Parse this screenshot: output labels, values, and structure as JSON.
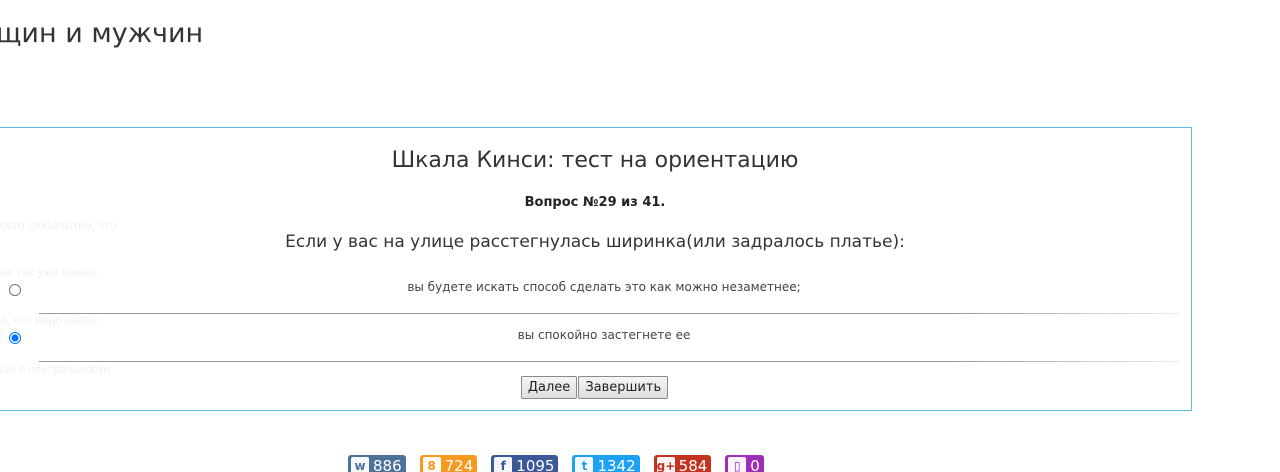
{
  "page": {
    "title": "щин и мужчин"
  },
  "ghost_lines": [
    {
      "text": "осто любопытно, что"
    },
    {
      "text": "не так уже важно,"
    },
    {
      "text": "а, что надо найти"
    },
    {
      "text": "ые о сексуальности"
    }
  ],
  "quiz": {
    "title": "Шкала Кинси: тест на ориентацию",
    "question_number": "Вопрос №29 из 41.",
    "question_text": "Если у вас на улице расстегнулась ширинка(или задралось платье):",
    "answers": [
      {
        "label": "вы будете искать способ сделать это как можно незаметнее;",
        "selected": false
      },
      {
        "label": "вы спокойно застегнете ее",
        "selected": true
      }
    ],
    "next_label": "Далее",
    "finish_label": "Завершить"
  },
  "share": {
    "buttons": [
      {
        "network": "vk",
        "icon": "vk-icon",
        "glyph": "w",
        "count": "886",
        "color": "#4d7198"
      },
      {
        "network": "odnoklassniki",
        "icon": "odnoklassniki-icon",
        "glyph": "8",
        "count": "724",
        "color": "#f59a1e"
      },
      {
        "network": "facebook",
        "icon": "facebook-icon",
        "glyph": "f",
        "count": "1095",
        "color": "#3b5998"
      },
      {
        "network": "twitter",
        "icon": "twitter-icon",
        "glyph": "t",
        "count": "1342",
        "color": "#1da1f2"
      },
      {
        "network": "google-plus",
        "icon": "google-plus-icon",
        "glyph": "g+",
        "count": "584",
        "color": "#c23321"
      },
      {
        "network": "other",
        "icon": "bookmark-icon",
        "glyph": "▯",
        "count": "0",
        "color": "#9c2fb7"
      }
    ]
  }
}
